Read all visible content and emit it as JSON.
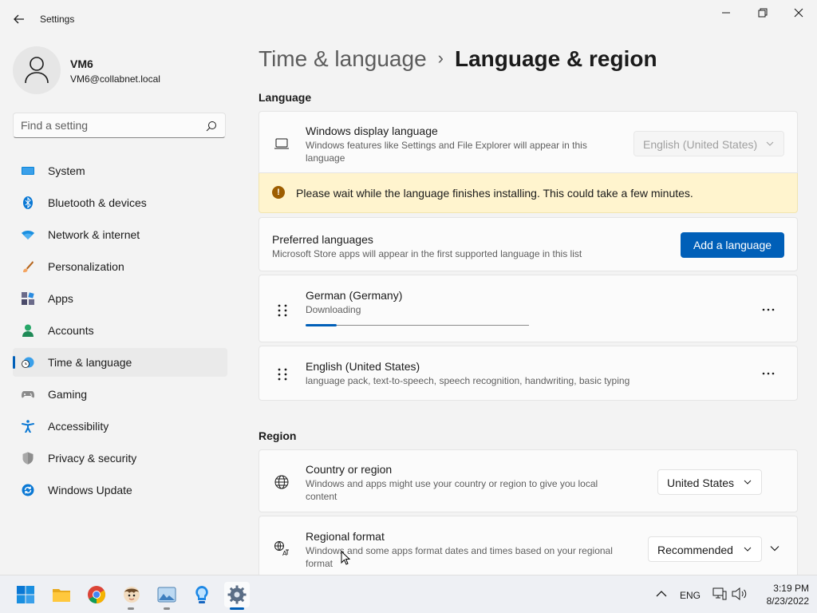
{
  "window": {
    "title": "Settings"
  },
  "profile": {
    "name": "VM6",
    "email": "VM6@collabnet.local"
  },
  "search": {
    "placeholder": "Find a setting"
  },
  "sidebar": {
    "items": [
      {
        "label": "System",
        "icon": "system-icon"
      },
      {
        "label": "Bluetooth & devices",
        "icon": "bluetooth-icon"
      },
      {
        "label": "Network & internet",
        "icon": "wifi-icon"
      },
      {
        "label": "Personalization",
        "icon": "brush-icon"
      },
      {
        "label": "Apps",
        "icon": "apps-icon"
      },
      {
        "label": "Accounts",
        "icon": "person-icon"
      },
      {
        "label": "Time & language",
        "icon": "clock-globe-icon",
        "active": true
      },
      {
        "label": "Gaming",
        "icon": "gamepad-icon"
      },
      {
        "label": "Accessibility",
        "icon": "accessibility-icon"
      },
      {
        "label": "Privacy & security",
        "icon": "shield-icon"
      },
      {
        "label": "Windows Update",
        "icon": "update-icon"
      }
    ]
  },
  "breadcrumb": {
    "parent": "Time & language",
    "separator": "›",
    "current": "Language & region"
  },
  "language": {
    "header": "Language",
    "display": {
      "title": "Windows display language",
      "desc": "Windows features like Settings and File Explorer will appear in this language",
      "value": "English (United States)"
    },
    "infobar": "Please wait while the language finishes installing. This could take a few minutes.",
    "preferred": {
      "title": "Preferred languages",
      "desc": "Microsoft Store apps will appear in the first supported language in this list",
      "button": "Add a language"
    },
    "languages": [
      {
        "name": "German (Germany)",
        "status": "Downloading",
        "progress": 0.14
      },
      {
        "name": "English (United States)",
        "status": "language pack, text-to-speech, speech recognition, handwriting, basic typing"
      }
    ]
  },
  "region": {
    "header": "Region",
    "country": {
      "title": "Country or region",
      "desc": "Windows and apps might use your country or region to give you local content",
      "value": "United States"
    },
    "format": {
      "title": "Regional format",
      "desc": "Windows and some apps format dates and times based on your regional format",
      "value": "Recommended"
    }
  },
  "taskbar": {
    "apps": [
      "start-icon",
      "file-explorer-icon",
      "chrome-icon",
      "game-app-icon",
      "photos-app-icon",
      "lightbulb-app-icon",
      "settings-app-icon"
    ],
    "tray": {
      "language": "ENG",
      "time": "3:19 PM",
      "date": "8/23/2022"
    }
  },
  "colors": {
    "accent": "#005fb8",
    "warning_bg": "#fff4ce",
    "warning_icon": "#9d5d00"
  }
}
